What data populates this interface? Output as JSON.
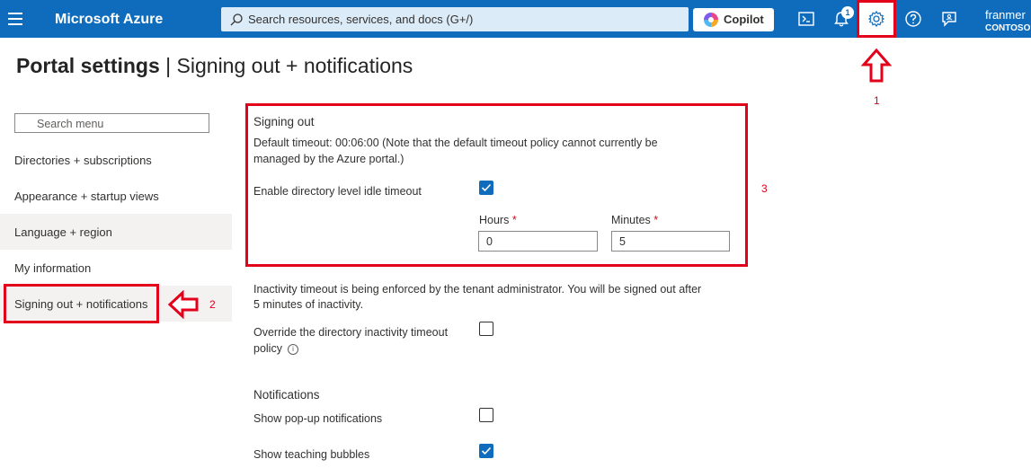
{
  "topbar": {
    "brand": "Microsoft Azure",
    "search_placeholder": "Search resources, services, and docs (G+/)",
    "copilot_label": "Copilot",
    "notification_count": "1",
    "user_name": "franmer",
    "user_org": "CONTOSO"
  },
  "page": {
    "title_main": "Portal settings",
    "title_separator": "|",
    "title_sub": "Signing out + notifications"
  },
  "sidebar": {
    "search_placeholder": "Search menu",
    "items": [
      {
        "label": "Directories + subscriptions"
      },
      {
        "label": "Appearance + startup views"
      },
      {
        "label": "Language + region"
      },
      {
        "label": "My information"
      },
      {
        "label": "Signing out + notifications"
      }
    ]
  },
  "signing_out": {
    "heading": "Signing out",
    "default_timeout_line1": "Default timeout: 00:06:00 (Note that the default timeout policy cannot currently be",
    "default_timeout_line2": "managed by the Azure portal.)",
    "enable_label": "Enable directory level idle timeout",
    "enable_checked": true,
    "hours_label": "Hours",
    "hours_value": "0",
    "minutes_label": "Minutes",
    "minutes_value": "5",
    "required_mark": "*",
    "enforced_line1": "Inactivity timeout is being enforced by the tenant administrator. You will be signed out after",
    "enforced_line2": "5 minutes of inactivity.",
    "override_line1": "Override the directory inactivity timeout",
    "override_line2": "policy",
    "override_checked": false
  },
  "notifications": {
    "heading": "Notifications",
    "popup_label": "Show pop-up notifications",
    "popup_checked": false,
    "bubbles_label": "Show teaching bubbles",
    "bubbles_checked": true
  },
  "annotations": {
    "marker_1": "1",
    "marker_2": "2",
    "marker_3": "3",
    "highlight_color": "#e3001b"
  },
  "icons": {
    "menu": "hamburger-icon",
    "search": "search-icon",
    "cloud_shell": "cloud-shell-icon",
    "notifications": "bell-icon",
    "settings": "gear-icon",
    "help": "help-icon",
    "feedback": "feedback-icon",
    "info": "info-icon"
  },
  "colors": {
    "topbar": "#0f6cbd",
    "accent": "#0f6cbd",
    "annotation_red": "#e3001b"
  }
}
